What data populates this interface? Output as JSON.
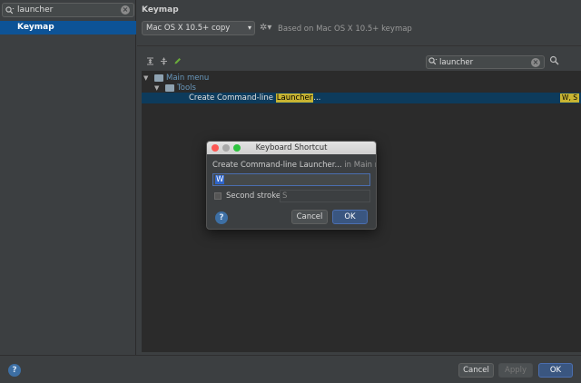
{
  "sidebar": {
    "search_value": "launcher",
    "items": [
      {
        "label": "Keymap",
        "selected": true
      }
    ]
  },
  "main": {
    "title": "Keymap",
    "keymap_select": "Mac OS X 10.5+ copy",
    "based_on": "Based on Mac OS X 10.5+ keymap",
    "tree_search_value": "launcher",
    "tree": {
      "main_menu": "Main menu",
      "tools": "Tools",
      "action_prefix": "Create Command-line ",
      "action_highlight": "Launcher",
      "action_suffix": "...",
      "action_shortcut": "W, S"
    }
  },
  "dialog": {
    "title": "Keyboard Shortcut",
    "description": "Create Command-line Launcher...",
    "context": " in Main menu",
    "first_stroke": "W",
    "second_stroke_label": "Second stroke:",
    "second_stroke_value": "S",
    "cancel": "Cancel",
    "ok": "OK"
  },
  "footer": {
    "cancel": "Cancel",
    "apply": "Apply",
    "ok": "OK"
  },
  "icons": {
    "help": "?",
    "clear": "×"
  },
  "colors": {
    "selection": "#0d5396",
    "highlight": "#c8b432",
    "primary_button": "#3a5680"
  }
}
